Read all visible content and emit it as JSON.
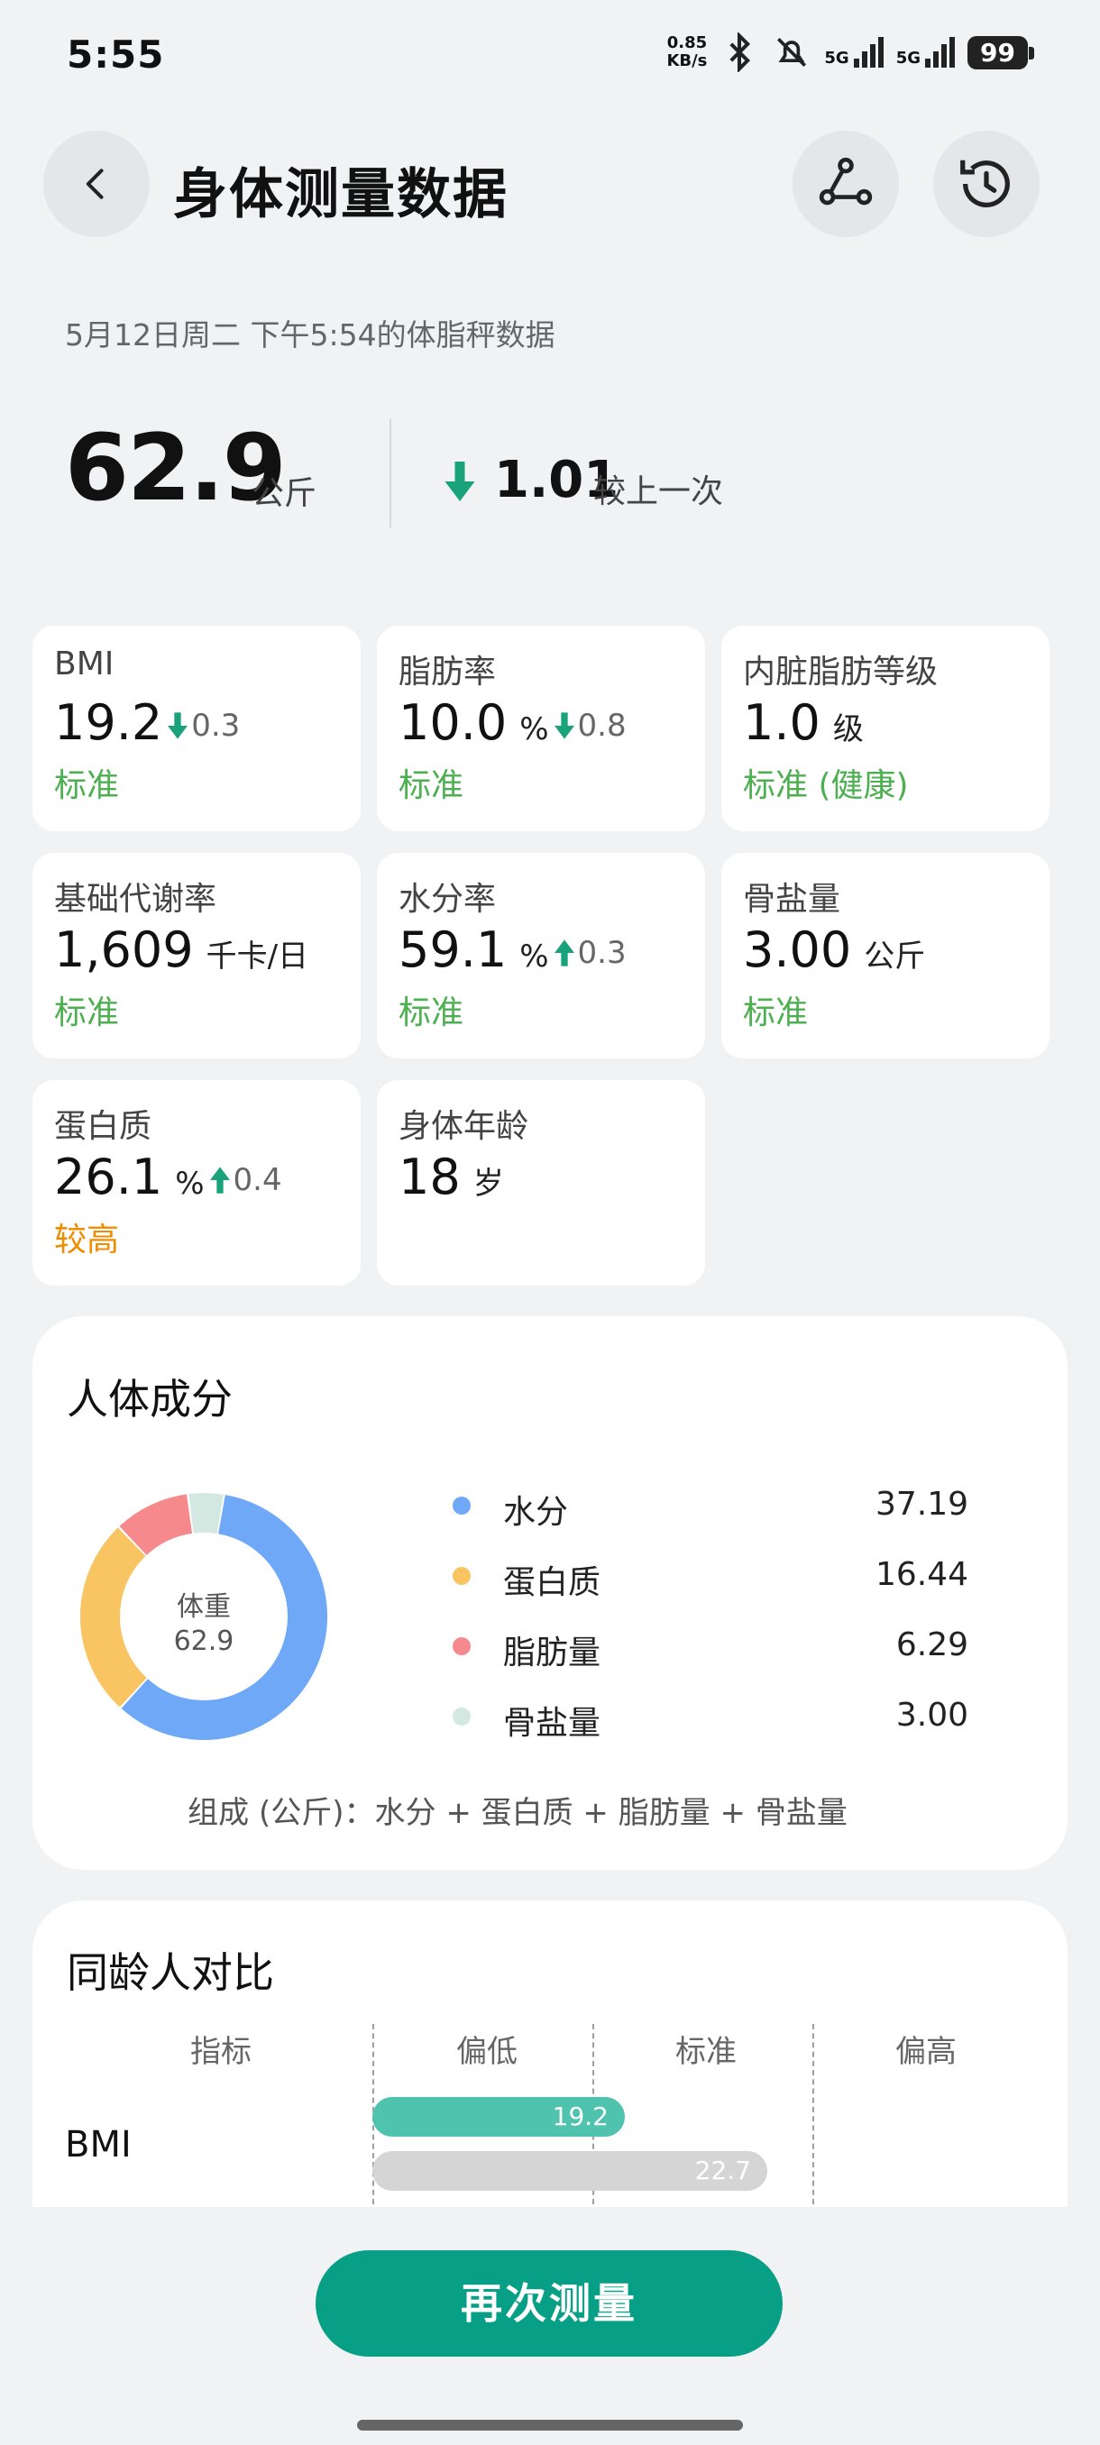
{
  "status_bar": {
    "time": "5:55",
    "net_speed_value": "0.85",
    "net_speed_unit": "KB/s",
    "sig1": "5G",
    "sig2": "5G",
    "battery": "99"
  },
  "header": {
    "title": "身体测量数据",
    "back_icon": "chevron-left-icon",
    "share_icon": "share-nodes-icon",
    "history_icon": "history-clock-icon"
  },
  "subtitle": "5月12日周二 下午5:54的体脂秤数据",
  "weight": {
    "value": "62.9",
    "unit": "公斤",
    "change_value": "1.01",
    "change_label": "较上一次",
    "change_direction": "down"
  },
  "metrics": [
    {
      "label": "BMI",
      "value": "19.2",
      "unit": "",
      "diff": "0.3",
      "diff_direction": "down",
      "status": "标准",
      "status_level": "standard"
    },
    {
      "label": "脂肪率",
      "value": "10.0",
      "unit": "%",
      "diff": "0.8",
      "diff_direction": "down",
      "status": "标准",
      "status_level": "standard"
    },
    {
      "label": "内脏脂肪等级",
      "value": "1.0",
      "unit": "级",
      "diff": "",
      "diff_direction": "",
      "status": "标准 (健康)",
      "status_level": "standard"
    },
    {
      "label": "基础代谢率",
      "value": "1,609",
      "unit": "千卡/日",
      "diff": "",
      "diff_direction": "",
      "status": "标准",
      "status_level": "standard"
    },
    {
      "label": "水分率",
      "value": "59.1",
      "unit": "%",
      "diff": "0.3",
      "diff_direction": "up",
      "status": "标准",
      "status_level": "standard"
    },
    {
      "label": "骨盐量",
      "value": "3.00",
      "unit": "公斤",
      "diff": "",
      "diff_direction": "",
      "status": "标准",
      "status_level": "standard"
    },
    {
      "label": "蛋白质",
      "value": "26.1",
      "unit": "%",
      "diff": "0.4",
      "diff_direction": "up",
      "status": "较高",
      "status_level": "high"
    },
    {
      "label": "身体年龄",
      "value": "18",
      "unit": "岁",
      "diff": "",
      "diff_direction": "",
      "status": "",
      "status_level": ""
    }
  ],
  "composition": {
    "title": "人体成分",
    "center_label": "体重",
    "center_value": "62.9",
    "items": [
      {
        "name": "水分",
        "value": "37.19",
        "color": "#6ea8f7"
      },
      {
        "name": "蛋白质",
        "value": "16.44",
        "color": "#f9c462"
      },
      {
        "name": "脂肪量",
        "value": "6.29",
        "color": "#f5898c"
      },
      {
        "name": "骨盐量",
        "value": "3.00",
        "color": "#d3e8e1"
      }
    ],
    "note": "组成 (公斤)：水分 + 蛋白质 + 脂肪量 + 骨盐量"
  },
  "peer": {
    "title": "同龄人对比",
    "columns": [
      "指标",
      "偏低",
      "标准",
      "偏高"
    ],
    "rows": [
      {
        "label": "BMI",
        "user_value": "19.2",
        "peer_value": "22.7",
        "user_color": "#4fc3ad",
        "peer_color": "#d5d5d5"
      }
    ]
  },
  "actions": {
    "measure_again": "再次测量"
  }
}
